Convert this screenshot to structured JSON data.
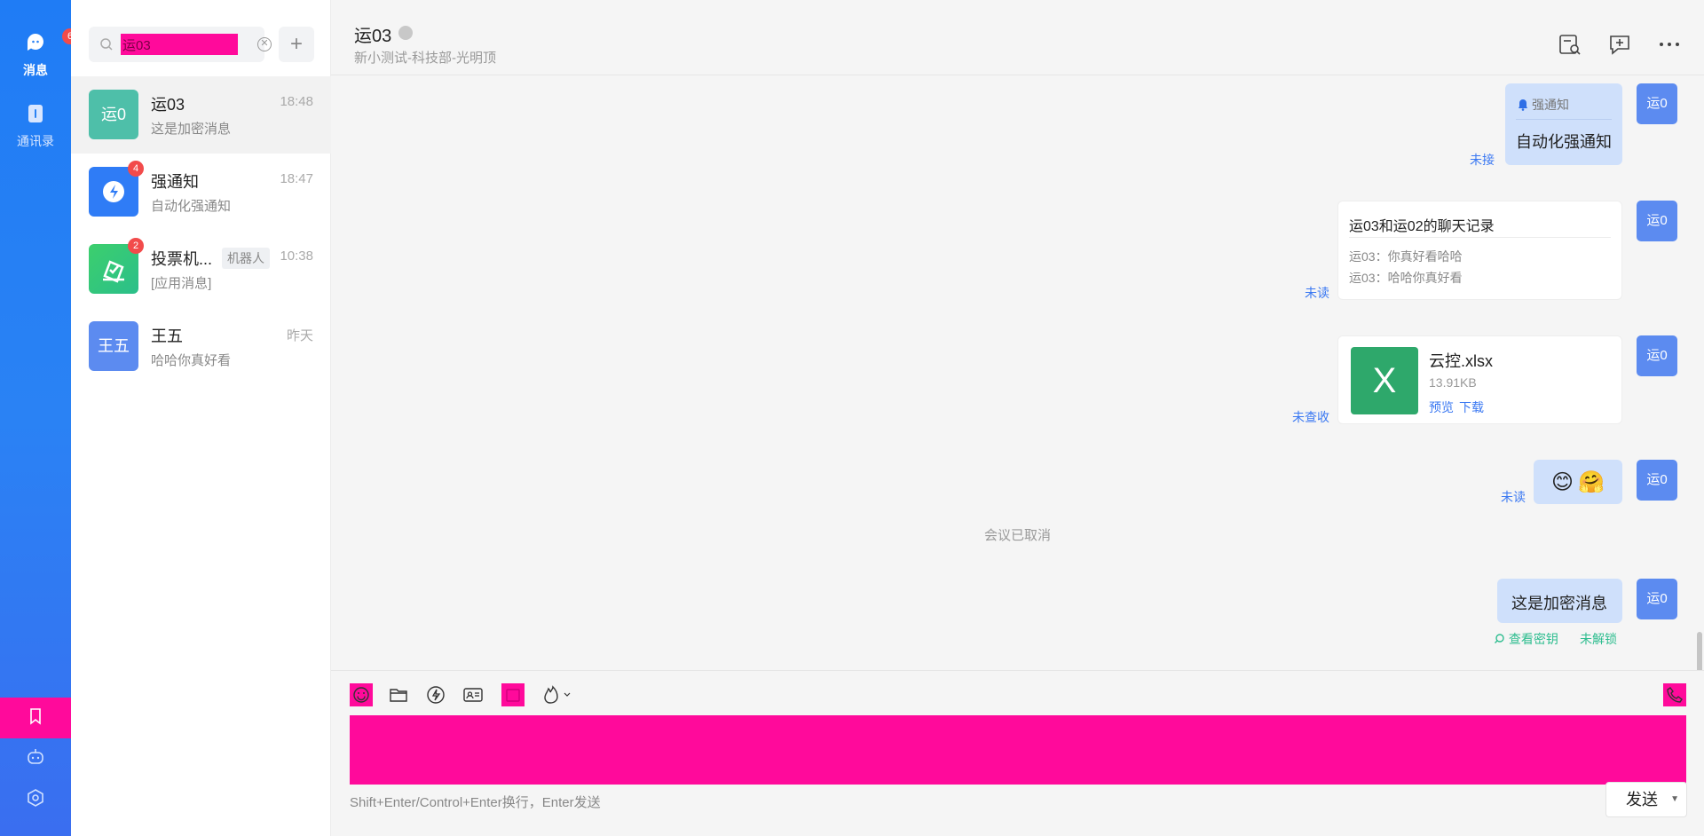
{
  "rail": {
    "messages": {
      "label": "消息",
      "badge": "6",
      "icon": "chat-bubble-icon"
    },
    "contacts": {
      "label": "通讯录",
      "icon": "contacts-book-icon"
    },
    "bottom_icons": [
      "bookmark-icon",
      "robot-icon",
      "settings-hexagon-icon"
    ]
  },
  "search": {
    "value": "运03",
    "icon": "search-icon",
    "clear_icon": "clear-circle-icon"
  },
  "add_button": "+",
  "conversations": [
    {
      "avatar_text": "运0",
      "avatar_color": "#4ebfa9",
      "name": "运03",
      "time": "18:48",
      "preview": "这是加密消息",
      "badge": "",
      "tag": "",
      "active": true
    },
    {
      "avatar_text": "",
      "avatar_color": "#2f7cf6",
      "avatar_icon": "lightning-bubble-icon",
      "name": "强通知",
      "time": "18:47",
      "preview": "自动化强通知",
      "badge": "4",
      "tag": ""
    },
    {
      "avatar_text": "",
      "avatar_color": "#3ccf6d",
      "avatar_icon": "vote-check-icon",
      "name": "投票机...",
      "time": "10:38",
      "preview": "[应用消息]",
      "badge": "2",
      "tag": "机器人"
    },
    {
      "avatar_text": "王五",
      "avatar_color": "#5c8bf0",
      "name": "王五",
      "time": "昨天",
      "preview": "哈哈你真好看",
      "badge": "",
      "tag": ""
    }
  ],
  "chat": {
    "title": "运03",
    "subtitle": "新小测试-科技部-光明顶",
    "header_icons": [
      "search-records-icon",
      "new-chat-icon",
      "more-icon"
    ],
    "sender_avatar": "运0",
    "messages": {
      "notice": {
        "header": "强通知",
        "text": "自动化强通知",
        "status": "未接"
      },
      "record": {
        "title": "运03和运02的聊天记录",
        "lines": [
          "运03：你真好看哈哈",
          "运03：哈哈你真好看"
        ],
        "status": "未读"
      },
      "file": {
        "icon_letter": "X",
        "name": "云控.xlsx",
        "size": "13.91KB",
        "preview": "预览",
        "download": "下载",
        "status": "未查收"
      },
      "emoji": {
        "items": [
          "😊",
          "🤗"
        ],
        "status": "未读"
      },
      "system": "会议已取消",
      "secret": {
        "text": "这是加密消息",
        "view_key": "查看密钥",
        "unlock": "未解锁"
      }
    }
  },
  "composer": {
    "tools": [
      "emoji-icon",
      "folder-icon",
      "lightning-icon",
      "contact-card-icon",
      "calendar-icon",
      "burn-after-read-icon"
    ],
    "call_icon": "phone-icon",
    "hint": "Shift+Enter/Control+Enter换行，Enter发送",
    "send_label": "发送"
  }
}
